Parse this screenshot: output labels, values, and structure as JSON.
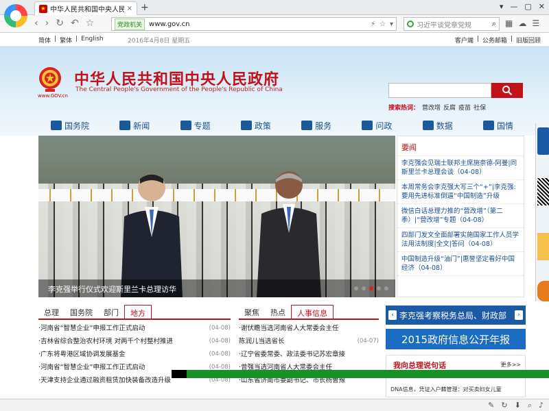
{
  "browser": {
    "tab_title": "中华人民共和国中央人民政府",
    "tab_close": "×",
    "new_tab": "+",
    "win_controls": [
      "▾",
      "—",
      "▢",
      "✕"
    ],
    "address_badge": "党政机关",
    "url": "www.gov.cn",
    "search_placeholder": "习近平谈党章党规"
  },
  "topline": {
    "langs": [
      "简体",
      "|",
      "繁体",
      "|",
      "English"
    ],
    "date": "2016年4月8日  星期五",
    "links": [
      "客户端",
      "|",
      "公务邮箱",
      "|",
      "旧版回顾"
    ]
  },
  "header": {
    "gov_url": "www.GOV.cn",
    "title": "中华人民共和国中央人民政府",
    "subtitle": "The Central People's Government of the People's Republic of China",
    "hot_label": "搜索热词：",
    "hot_words": [
      "营改增",
      "反腐",
      "疫苗",
      "社保"
    ]
  },
  "nav": [
    {
      "label": "国务院",
      "icon": "building-icon"
    },
    {
      "label": "新闻",
      "icon": "newspaper-icon"
    },
    {
      "label": "专题",
      "icon": "calendar-icon"
    },
    {
      "label": "政策",
      "icon": "document-icon"
    },
    {
      "label": "服务",
      "icon": "thumbs-up-icon"
    },
    {
      "label": "问政",
      "icon": "chat-icon"
    },
    {
      "label": "数据",
      "icon": "bar-chart-icon"
    },
    {
      "label": "国情",
      "icon": "china-map-icon"
    }
  ],
  "hero": {
    "caption": "李克强举行仪式欢迎斯里兰卡总理访华"
  },
  "news": {
    "heading": "要闻",
    "items": [
      "李克强会见瑞士联邦主席施奈德-阿曼|同斯里兰卡总理会谈（04-08）",
      "本周常务会李克强大写三个“+”|李克强:要用先进标准倒逼“中国制造”升级",
      "微信白话总理力推的“营改增”（第二季）|“营改增”专题（04-08）",
      "四部门发文全面部署实施国家工作人员学法用法制度|全文|答问（04-08）",
      "中国制造升级“油门”|惠誉坚定看好中国经济（04-08）"
    ]
  },
  "tabs_left": {
    "tabs": [
      "总理",
      "国务院",
      "部门",
      "地方"
    ],
    "items": [
      {
        "text": "·河南省“智慧企业”申报工作正式启动",
        "date": "(04-08)"
      },
      {
        "text": "·吉林省综合整治农村环境 对两千个村整村推进",
        "date": "(04-08)"
      },
      {
        "text": "·广东将粤港区域协调发展基金",
        "date": "(04-08)"
      },
      {
        "text": "·河南省“智慧企业”申报工作正式启动",
        "date": "(04-08)"
      },
      {
        "text": "·天津支持企业通过融资租赁加快装备改造升级",
        "date": "(04-08)"
      }
    ]
  },
  "tabs_right": {
    "tabs": [
      "聚焦",
      "热点",
      "人事信息"
    ],
    "items": [
      {
        "text": "·谢伏瞻当选河南省人大常委会主任",
        "date": ""
      },
      {
        "text": "  陈润儿当选省长",
        "date": "(04-07)"
      },
      {
        "text": "·辽宁省委常委、政法委书记苏宏章接",
        "date": ""
      },
      {
        "text": "·曾强当选河南省人大常委会主任",
        "date": ""
      },
      {
        "text": "·山东省济南市委副书记、市长杨鲁豫",
        "date": ""
      }
    ]
  },
  "banners": {
    "b1": "李克强考察税务总局、财政部",
    "b2": "2015政府信息公开年报",
    "card_title": "我向总理说句话",
    "card_more": "更多>>",
    "card_sub": "DNA信息，凭证入户籍管理：对买卖妇女儿童"
  }
}
